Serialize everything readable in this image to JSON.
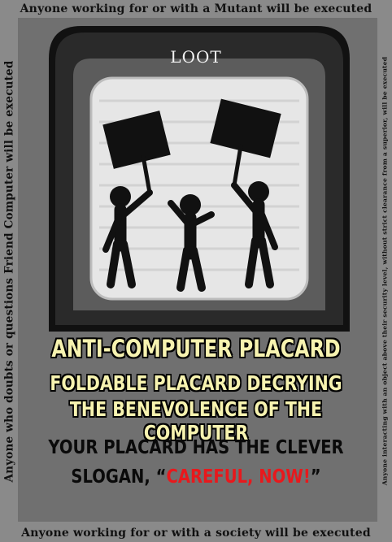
{
  "card": {
    "border_top": "Anyone working for or with a Mutant will be executed",
    "border_bottom": "Anyone working for or with a society will be executed",
    "border_left": "Anyone who doubts or questions Friend Computer will be executed",
    "border_right": "Anyone interacting with an object above their security level, without strict clearance from a superior, will be executed",
    "category": "LOOT",
    "item_name": "ANTI-COMPUTER PLACARD",
    "subtitle_line1": "FOLDABLE PLACARD DECRYING",
    "subtitle_line2": "THE BENEVOLENCE OF THE COMPUTER",
    "desc_line1": "YOUR PLACARD HAS THE CLEVER",
    "desc_line2_prefix": "SLOGAN, “",
    "slogan": "CAREFUL, NOW!",
    "desc_line2_suffix": "”"
  },
  "colors": {
    "card_bg": "#8a8a8a",
    "inner_bg": "#707070",
    "title_fill": "#f7f3b0",
    "slogan_red": "#e8181c"
  },
  "icons": [
    "protesters-with-placards-icon"
  ]
}
